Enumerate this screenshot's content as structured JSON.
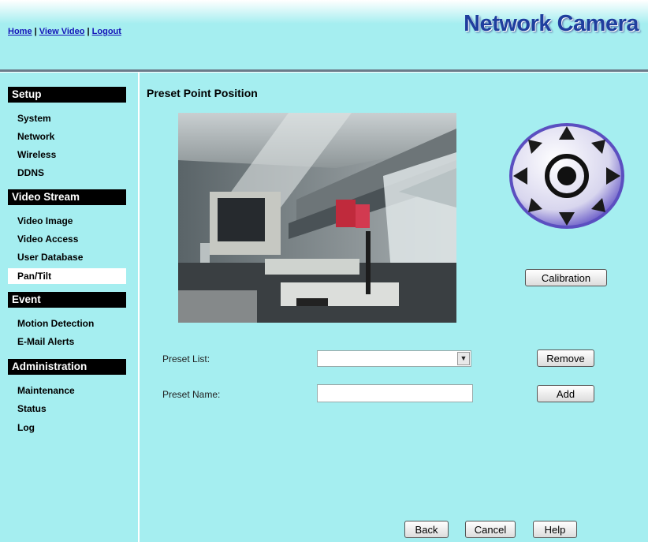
{
  "header": {
    "links": [
      "Home",
      "View Video",
      "Logout"
    ],
    "separator": "|",
    "brand": "Network Camera"
  },
  "sidebar": {
    "sections": [
      {
        "title": "Setup",
        "items": [
          "System",
          "Network",
          "Wireless",
          "DDNS"
        ]
      },
      {
        "title": "Video Stream",
        "items": [
          "Video Image",
          "Video Access",
          "User Database",
          "Pan/Tilt"
        ]
      },
      {
        "title": "Event",
        "items": [
          "Motion Detection",
          "E-Mail Alerts"
        ]
      },
      {
        "title": "Administration",
        "items": [
          "Maintenance",
          "Status",
          "Log"
        ]
      }
    ],
    "active_item": "Pan/Tilt"
  },
  "main": {
    "title": "Preset Point Position",
    "calibration_label": "Calibration",
    "preset_list_label": "Preset List:",
    "preset_list_value": "",
    "remove_label": "Remove",
    "preset_name_label": "Preset Name:",
    "preset_name_value": "",
    "add_label": "Add",
    "back_label": "Back",
    "cancel_label": "Cancel",
    "help_label": "Help"
  },
  "colors": {
    "background": "#a5eef0",
    "section_bar": "#000000",
    "link": "#1414b8",
    "brand": "#1f3e9e"
  }
}
